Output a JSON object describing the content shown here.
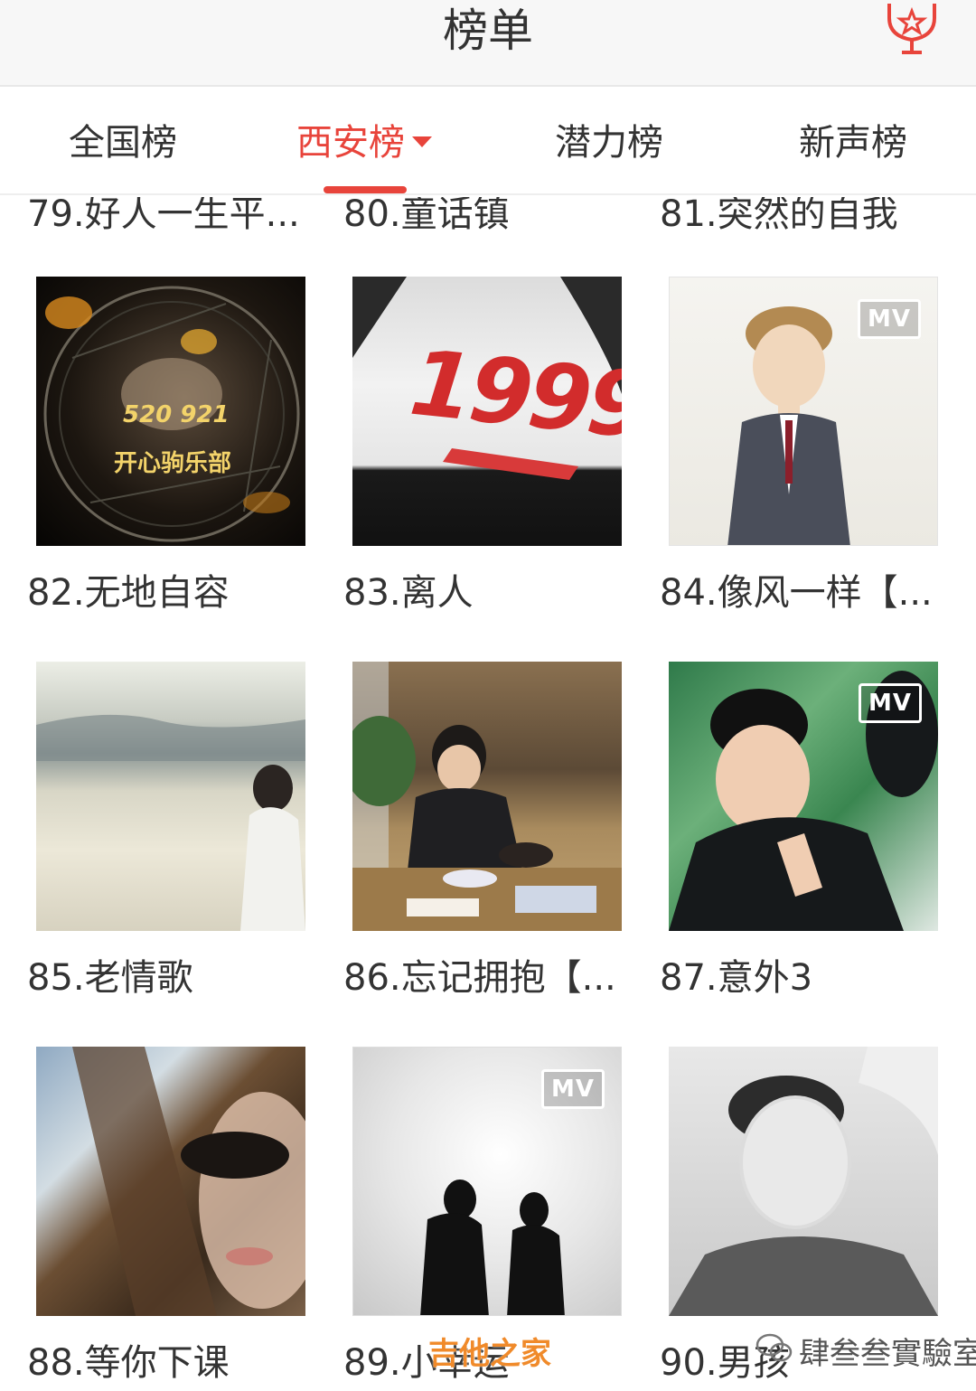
{
  "header": {
    "title": "榜单",
    "trophy_icon": "trophy-icon"
  },
  "tabs": [
    {
      "label": "全国榜",
      "active": false
    },
    {
      "label": "西安榜",
      "active": true
    },
    {
      "label": "潜力榜",
      "active": false
    },
    {
      "label": "新声榜",
      "active": false
    }
  ],
  "previous_row": [
    "79.好人一生平...",
    "80.童话镇",
    "81.突然的自我"
  ],
  "songs": [
    {
      "caption": "82.无地自容",
      "cover_text": [
        "520 921",
        "开心驹乐部"
      ],
      "mv": false
    },
    {
      "caption": "83.离人",
      "cover_text": [
        "1999"
      ],
      "mv": false
    },
    {
      "caption": "84.像风一样【...",
      "mv": true,
      "mv_label": "MV"
    },
    {
      "caption": "85.老情歌",
      "mv": false
    },
    {
      "caption": "86.忘记拥抱【...",
      "mv": false
    },
    {
      "caption": "87.意外3",
      "mv": true,
      "mv_label": "MV"
    },
    {
      "caption": "88.等你下课",
      "mv": false
    },
    {
      "caption": "89.小幸运",
      "mv": true,
      "mv_label": "MV"
    },
    {
      "caption": "90.男孩",
      "mv": false
    }
  ],
  "watermarks": {
    "left": "吉他之家",
    "right": "肆叁叁實驗室"
  },
  "colors": {
    "accent": "#e8443b",
    "text": "#333333",
    "header_bg": "#f7f7f7"
  }
}
